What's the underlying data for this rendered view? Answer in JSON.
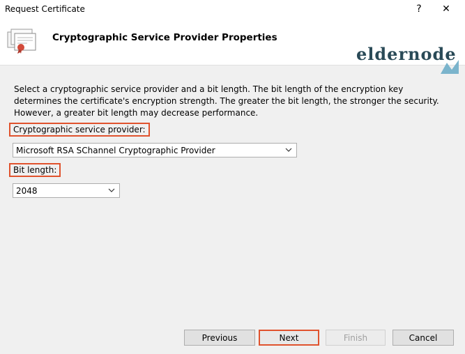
{
  "window": {
    "title": "Request Certificate",
    "help_label": "?",
    "close_label": "✕"
  },
  "header": {
    "title": "Cryptographic Service Provider Properties",
    "brand": "eldernode"
  },
  "description": "Select a cryptographic service provider and a bit length. The bit length of the encryption key determines the certificate's encryption strength. The greater the bit length, the stronger the security. However, a greater bit length may decrease performance.",
  "csp": {
    "label": "Cryptographic service provider:",
    "value": "Microsoft RSA SChannel Cryptographic Provider"
  },
  "bit_length": {
    "label": "Bit length:",
    "value": "2048"
  },
  "buttons": {
    "previous": "Previous",
    "next": "Next",
    "finish": "Finish",
    "cancel": "Cancel"
  },
  "colors": {
    "highlight": "#e0522d",
    "brand": "#2a4a57"
  }
}
